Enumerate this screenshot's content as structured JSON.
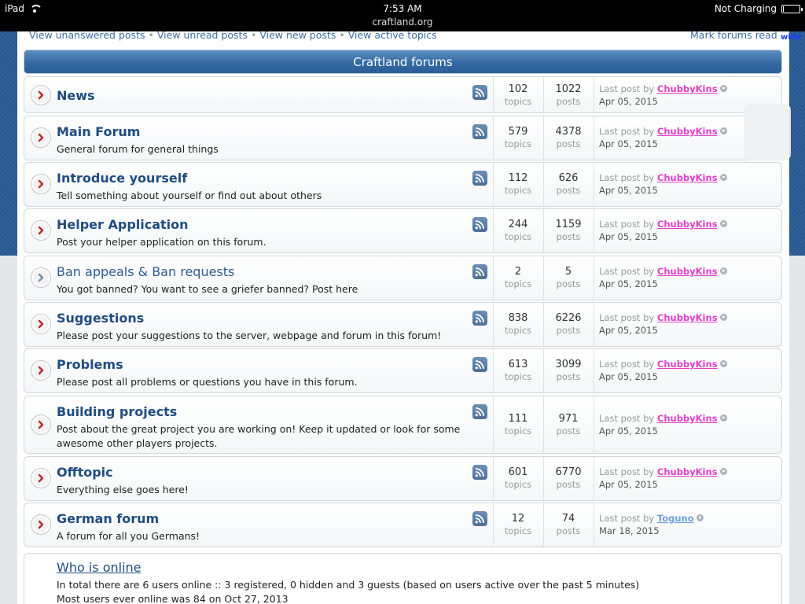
{
  "statusbar": {
    "device": "iPad",
    "time": "7:53 AM",
    "url": "craftland.org",
    "charging": "Not Charging",
    "battery_fraction": 0.05
  },
  "toplinks": [
    "View unanswered posts",
    "View unread posts",
    "View new posts",
    "View active topics"
  ],
  "mark_read": "Mark forums read",
  "wide_label": "wide",
  "header": {
    "title": "Craftland forums"
  },
  "labels": {
    "topics": "topics",
    "posts": "posts",
    "last_post_by": "Last post by"
  },
  "forums": [
    {
      "name": "News",
      "desc": "",
      "topics": "102",
      "posts": "1022",
      "user": "ChubbyKins",
      "user_color": "#e040c8",
      "date": "Apr 05, 2015",
      "bold": true
    },
    {
      "name": "Main Forum",
      "desc": "General forum for general things",
      "topics": "579",
      "posts": "4378",
      "user": "ChubbyKins",
      "user_color": "#e040c8",
      "date": "Apr 05, 2015",
      "bold": true
    },
    {
      "name": "Introduce yourself",
      "desc": "Tell something about yourself or find out about others",
      "topics": "112",
      "posts": "626",
      "user": "ChubbyKins",
      "user_color": "#e040c8",
      "date": "Apr 05, 2015",
      "bold": true
    },
    {
      "name": "Helper Application",
      "desc": "Post your helper application on this forum.",
      "topics": "244",
      "posts": "1159",
      "user": "ChubbyKins",
      "user_color": "#e040c8",
      "date": "Apr 05, 2015",
      "bold": true
    },
    {
      "name": "Ban appeals & Ban requests",
      "desc": "You got banned? You want to see a griefer banned? Post here",
      "topics": "2",
      "posts": "5",
      "user": "ChubbyKins",
      "user_color": "#e040c8",
      "date": "Apr 05, 2015",
      "bold": false
    },
    {
      "name": "Suggestions",
      "desc": "Please post your suggestions to the server, webpage and forum in this forum!",
      "topics": "838",
      "posts": "6226",
      "user": "ChubbyKins",
      "user_color": "#e040c8",
      "date": "Apr 05, 2015",
      "bold": true
    },
    {
      "name": "Problems",
      "desc": "Please post all problems or questions you have in this forum.",
      "topics": "613",
      "posts": "3099",
      "user": "ChubbyKins",
      "user_color": "#e040c8",
      "date": "Apr 05, 2015",
      "bold": true
    },
    {
      "name": "Building projects",
      "desc": "Post about the great project you are working on! Keep it updated or look for some awesome other players projects.",
      "topics": "111",
      "posts": "971",
      "user": "ChubbyKins",
      "user_color": "#e040c8",
      "date": "Apr 05, 2015",
      "bold": true
    },
    {
      "name": "Offtopic",
      "desc": "Everything else goes here!",
      "topics": "601",
      "posts": "6770",
      "user": "ChubbyKins",
      "user_color": "#e040c8",
      "date": "Apr 05, 2015",
      "bold": true
    },
    {
      "name": "German forum",
      "desc": "A forum for all you Germans!",
      "topics": "12",
      "posts": "74",
      "user": "Toguno",
      "user_color": "#6aa0d8",
      "date": "Mar 18, 2015",
      "bold": true
    }
  ],
  "whos_online": {
    "title": "Who is online",
    "line1": "In total there are 6 users online :: 3 registered, 0 hidden and 3 guests (based on users active over the past 5 minutes)",
    "line2": "Most users ever online was 84 on Oct 27, 2013"
  },
  "colors": {
    "accent": "#1f4c80",
    "header_blue": "#346aa3",
    "unread_arrow": "#b52a2a",
    "read_arrow": "#6f8eb3"
  }
}
